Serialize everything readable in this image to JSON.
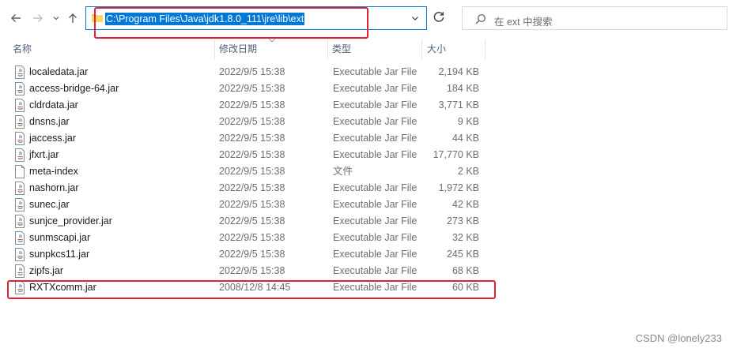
{
  "toolbar": {
    "address": "C:\\Program Files\\Java\\jdk1.8.0_111\\jre\\lib\\ext",
    "search_placeholder": "在 ext 中搜索"
  },
  "columns": {
    "name": "名称",
    "date": "修改日期",
    "type": "类型",
    "size": "大小"
  },
  "files": [
    {
      "name": "localedata.jar",
      "date": "2022/9/5 15:38",
      "type": "Executable Jar File",
      "size": "2,194 KB",
      "icon": "jar-file-icon"
    },
    {
      "name": "access-bridge-64.jar",
      "date": "2022/9/5 15:38",
      "type": "Executable Jar File",
      "size": "184 KB",
      "icon": "jar-file-icon"
    },
    {
      "name": "cldrdata.jar",
      "date": "2022/9/5 15:38",
      "type": "Executable Jar File",
      "size": "3,771 KB",
      "icon": "jar-file-icon"
    },
    {
      "name": "dnsns.jar",
      "date": "2022/9/5 15:38",
      "type": "Executable Jar File",
      "size": "9 KB",
      "icon": "jar-file-icon"
    },
    {
      "name": "jaccess.jar",
      "date": "2022/9/5 15:38",
      "type": "Executable Jar File",
      "size": "44 KB",
      "icon": "jar-file-icon"
    },
    {
      "name": "jfxrt.jar",
      "date": "2022/9/5 15:38",
      "type": "Executable Jar File",
      "size": "17,770 KB",
      "icon": "jar-file-icon"
    },
    {
      "name": "meta-index",
      "date": "2022/9/5 15:38",
      "type": "文件",
      "size": "2 KB",
      "icon": "blank-file-icon"
    },
    {
      "name": "nashorn.jar",
      "date": "2022/9/5 15:38",
      "type": "Executable Jar File",
      "size": "1,972 KB",
      "icon": "jar-file-icon"
    },
    {
      "name": "sunec.jar",
      "date": "2022/9/5 15:38",
      "type": "Executable Jar File",
      "size": "42 KB",
      "icon": "jar-file-icon"
    },
    {
      "name": "sunjce_provider.jar",
      "date": "2022/9/5 15:38",
      "type": "Executable Jar File",
      "size": "273 KB",
      "icon": "jar-file-icon"
    },
    {
      "name": "sunmscapi.jar",
      "date": "2022/9/5 15:38",
      "type": "Executable Jar File",
      "size": "32 KB",
      "icon": "jar-file-icon"
    },
    {
      "name": "sunpkcs11.jar",
      "date": "2022/9/5 15:38",
      "type": "Executable Jar File",
      "size": "245 KB",
      "icon": "jar-file-icon"
    },
    {
      "name": "zipfs.jar",
      "date": "2022/9/5 15:38",
      "type": "Executable Jar File",
      "size": "68 KB",
      "icon": "jar-file-icon"
    },
    {
      "name": "RXTXcomm.jar",
      "date": "2008/12/8 14:45",
      "type": "Executable Jar File",
      "size": "60 KB",
      "icon": "jar-file-icon"
    }
  ],
  "watermark": "CSDN @lonely233",
  "colors": {
    "accent": "#0078d7",
    "highlight_box": "#e0232f",
    "header_text": "#4c607a"
  }
}
